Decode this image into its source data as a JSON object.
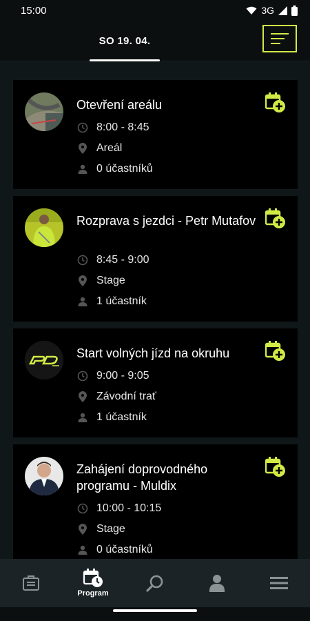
{
  "status_bar": {
    "time": "15:00",
    "network": "3G"
  },
  "header": {
    "date_tab": "SO 19. 04.",
    "menu_icon": "menu-lines-icon"
  },
  "accent_color": "#d2ea45",
  "events": [
    {
      "title": "Otevření areálu",
      "time": "8:00 - 8:45",
      "place": "Areál",
      "participants": "0 účastníků",
      "avatar": "racetrack-aerial-photo"
    },
    {
      "title": "Rozprava s jezdci - Petr Mutafov",
      "time": "8:45 - 9:00",
      "place": "Stage",
      "participants": "1 účastník",
      "avatar": "person-yellow-jacket-photo"
    },
    {
      "title": "Start volných jízd na okruhu",
      "time": "9:00 - 9:05",
      "place": "Závodní trať",
      "participants": "1 účastník",
      "avatar": "pd-logo"
    },
    {
      "title": "Zahájení doprovodného programu - Muldix",
      "time": "10:00 - 10:15",
      "place": "Stage",
      "participants": "0 účastníků",
      "avatar": "man-in-suit-photo"
    }
  ],
  "bottom_nav": {
    "items": [
      {
        "icon": "ticket-icon",
        "label": ""
      },
      {
        "icon": "calendar-clock-icon",
        "label": "Program"
      },
      {
        "icon": "search-icon",
        "label": ""
      },
      {
        "icon": "user-icon",
        "label": ""
      },
      {
        "icon": "menu-icon",
        "label": ""
      }
    ]
  }
}
